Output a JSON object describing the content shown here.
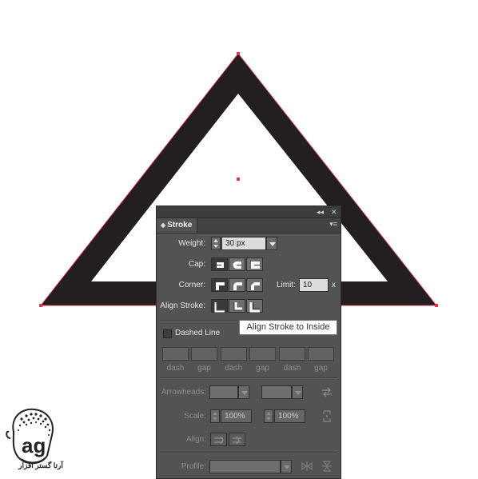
{
  "panel": {
    "tab_arrows": "◆",
    "title": "Stroke",
    "collapse_ctl": "◂◂",
    "close_ctl": "✕",
    "menu_glyph": "▾≡"
  },
  "weight": {
    "label": "Weight:",
    "value": "30 px"
  },
  "cap": {
    "label": "Cap:"
  },
  "corner": {
    "label": "Corner:",
    "limit_label": "Limit:",
    "limit_value": "10",
    "limit_unit": "x"
  },
  "align_stroke": {
    "label": "Align Stroke:",
    "tooltip": "Align Stroke to Inside"
  },
  "dashed": {
    "label": "Dashed Line",
    "slots": [
      "dash",
      "gap",
      "dash",
      "gap",
      "dash",
      "gap"
    ]
  },
  "arrowheads": {
    "label": "Arrowheads:"
  },
  "scale": {
    "label": "Scale:",
    "start": "100%",
    "end": "100%"
  },
  "align": {
    "label": "Align:"
  },
  "profile": {
    "label": "Profile:"
  },
  "watermark": {
    "text": "آرتا گستر افزار"
  },
  "colors": {
    "stroke": "#231f20",
    "anchor": "#e8304a",
    "panel_bg": "#535353"
  }
}
